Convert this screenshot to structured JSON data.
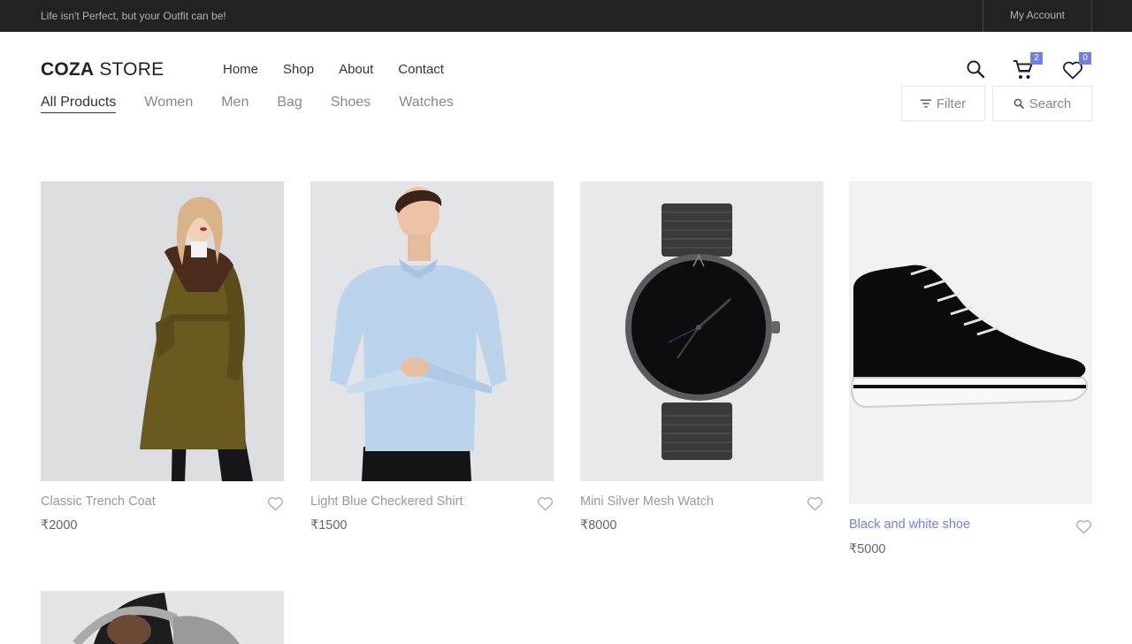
{
  "topbar": {
    "promo": "Life isn't Perfect, but your Outfit can be!",
    "account": "My Account"
  },
  "logo": {
    "bold": "COZA",
    "rest": " STORE"
  },
  "nav": [
    "Home",
    "Shop",
    "About",
    "Contact"
  ],
  "header_icons": {
    "search": "search-icon",
    "cart": "cart-icon",
    "wishlist": "heart-icon",
    "cart_count": "2",
    "wishlist_count": "0"
  },
  "categories": [
    "All Products",
    "Women",
    "Men",
    "Bag",
    "Shoes",
    "Watches"
  ],
  "active_category": "All Products",
  "tools": {
    "filter": "Filter",
    "search": "Search"
  },
  "products": [
    {
      "name": "Classic Trench Coat",
      "price": "₹2000"
    },
    {
      "name": "Light Blue Checkered Shirt",
      "price": "₹1500"
    },
    {
      "name": "Mini Silver Mesh Watch",
      "price": "₹8000"
    },
    {
      "name": "Black and white shoe",
      "price": "₹5000"
    }
  ],
  "colors": {
    "accent": "#717fe0",
    "topbar": "#222222"
  }
}
